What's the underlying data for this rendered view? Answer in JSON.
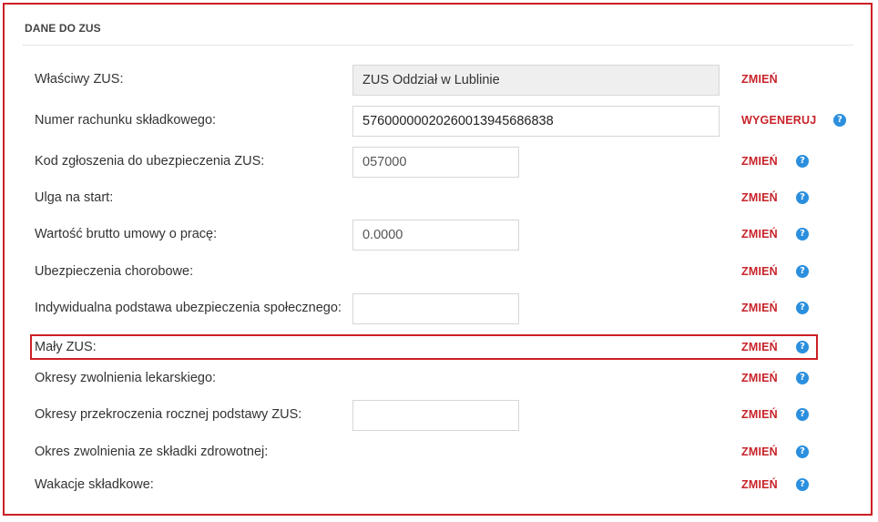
{
  "section": {
    "title": "DANE DO ZUS"
  },
  "rows": [
    {
      "label": "Właściwy ZUS:",
      "field_value": "ZUS Oddział w Lublinie",
      "action": "ZMIEŃ",
      "help_icon": "question-circle"
    },
    {
      "label": "Numer rachunku składkowego:",
      "field_value": "57600000020260013945686838",
      "action": "WYGENERUJ",
      "help_icon": "question-circle"
    },
    {
      "label": "Kod zgłoszenia do ubezpieczenia ZUS:",
      "field_value": "057000",
      "action": "ZMIEŃ",
      "help_icon": "question-circle"
    },
    {
      "label": "Ulga na start:",
      "action": "ZMIEŃ",
      "help_icon": "question-circle"
    },
    {
      "label": "Wartość brutto umowy o pracę:",
      "field_value": "0.0000",
      "action": "ZMIEŃ",
      "help_icon": "question-circle"
    },
    {
      "label": "Ubezpieczenia chorobowe:",
      "action": "ZMIEŃ",
      "help_icon": "question-circle"
    },
    {
      "label": "Indywidualna podstawa ubezpieczenia społecznego:",
      "field_value": "",
      "action": "ZMIEŃ",
      "help_icon": "question-circle"
    },
    {
      "label": "Mały ZUS:",
      "action": "ZMIEŃ",
      "help_icon": "question-circle"
    },
    {
      "label": "Okresy zwolnienia lekarskiego:",
      "action": "ZMIEŃ",
      "help_icon": "question-circle"
    },
    {
      "label": "Okresy przekroczenia rocznej podstawy ZUS:",
      "field_value": "",
      "action": "ZMIEŃ",
      "help_icon": "question-circle"
    },
    {
      "label": "Okres zwolnienia ze składki zdrowotnej:",
      "action": "ZMIEŃ",
      "help_icon": "question-circle"
    },
    {
      "label": "Wakacje składkowe:",
      "action": "ZMIEŃ",
      "help_icon": "question-circle"
    }
  ],
  "help_glyph": "?",
  "colors": {
    "action": "#c8232a",
    "frame_border": "#cc1f24",
    "help_icon": "#2b8fde",
    "readonly_field": "#efefef"
  }
}
